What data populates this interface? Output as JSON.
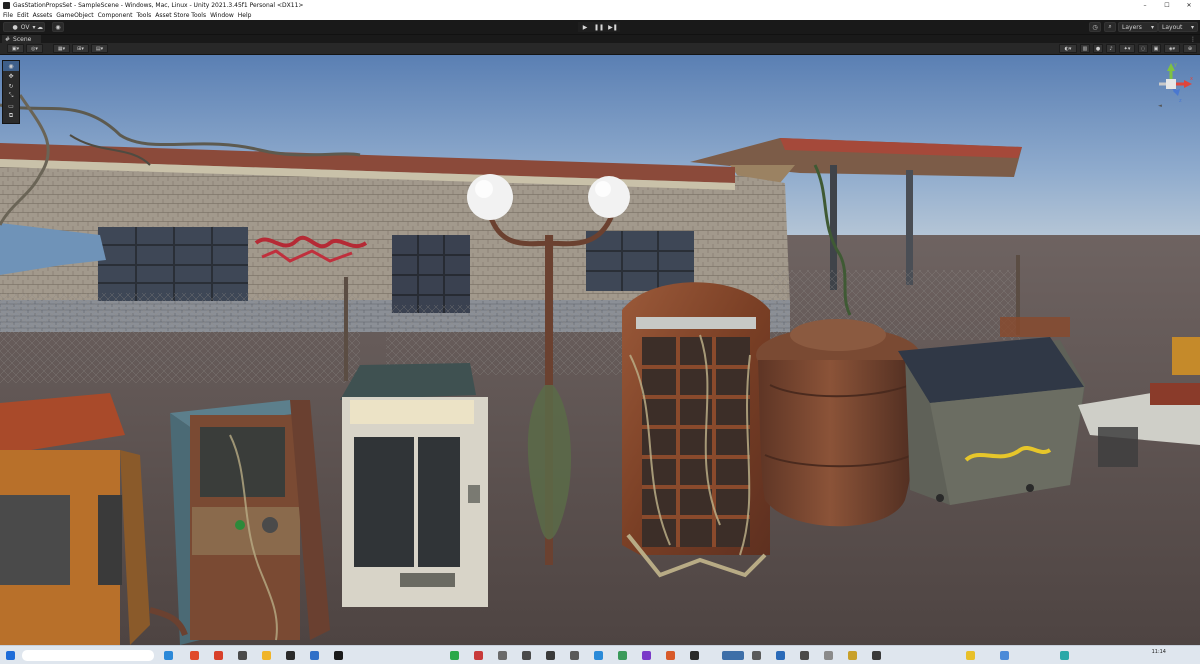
{
  "window": {
    "title": "GasStationPropsSet - SampleScene - Windows, Mac, Linux - Unity 2021.3.45f1 Personal <DX11>",
    "controls": [
      "–",
      "☐",
      "✕"
    ]
  },
  "menu": [
    "File",
    "Edit",
    "Assets",
    "GameObject",
    "Component",
    "Tools",
    "Asset Store Tools",
    "Window",
    "Help"
  ],
  "toolbar": {
    "account_label": "OV",
    "layers_label": "Layers",
    "layout_label": "Layout",
    "play_icons": [
      "▶",
      "❚❚",
      "▶❚"
    ]
  },
  "scene_tab": {
    "label": "Scene",
    "menu_glyph": "⋮"
  },
  "tools": [
    "view-tool-icon",
    "move-tool-icon",
    "rotate-tool-icon",
    "scale-tool-icon",
    "rect-tool-icon",
    "transform-tool-icon"
  ],
  "gizmo": {
    "y": "y",
    "x": "x",
    "z": "z"
  },
  "clock": "11:14",
  "colors": {
    "accent": "#3e5f8a",
    "sky_top": "#5c82b6",
    "sky_horizon": "#bccbd8",
    "ground": "#59504d",
    "rust": "#8a4a2c"
  }
}
